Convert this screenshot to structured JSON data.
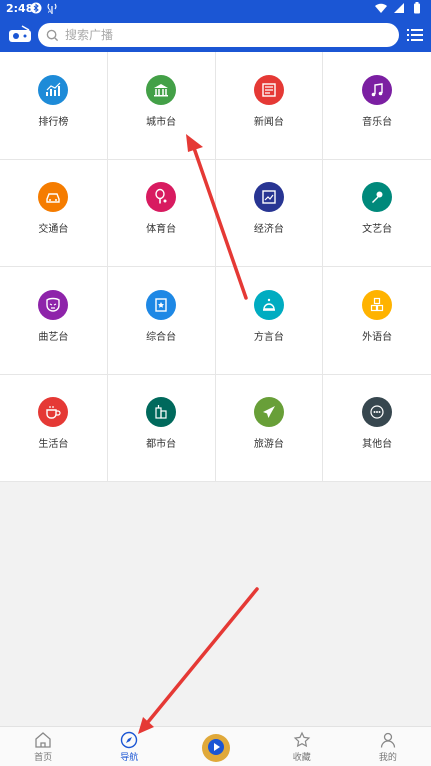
{
  "status": {
    "time": "2:48"
  },
  "search": {
    "placeholder": "搜索广播"
  },
  "categories": [
    {
      "label": "排行榜",
      "icon": "chart-growth-icon",
      "color": "#1e8bd8"
    },
    {
      "label": "城市台",
      "icon": "bank-building-icon",
      "color": "#43a047"
    },
    {
      "label": "新闻台",
      "icon": "newspaper-icon",
      "color": "#e53935"
    },
    {
      "label": "音乐台",
      "icon": "music-note-icon",
      "color": "#7b1fa2"
    },
    {
      "label": "交通台",
      "icon": "car-icon",
      "color": "#f57c00"
    },
    {
      "label": "体育台",
      "icon": "badminton-icon",
      "color": "#d81b60"
    },
    {
      "label": "经济台",
      "icon": "finance-chart-icon",
      "color": "#283593"
    },
    {
      "label": "文艺台",
      "icon": "microphone-icon",
      "color": "#00897b"
    },
    {
      "label": "曲艺台",
      "icon": "opera-mask-icon",
      "color": "#8e24aa"
    },
    {
      "label": "综合台",
      "icon": "book-star-icon",
      "color": "#1e88e5"
    },
    {
      "label": "方言台",
      "icon": "bell-icon",
      "color": "#00acc1"
    },
    {
      "label": "外语台",
      "icon": "letter-blocks-icon",
      "color": "#ffb300"
    },
    {
      "label": "生活台",
      "icon": "coffee-cup-icon",
      "color": "#e53935"
    },
    {
      "label": "都市台",
      "icon": "city-buildings-icon",
      "color": "#00695c"
    },
    {
      "label": "旅游台",
      "icon": "airplane-icon",
      "color": "#689f38"
    },
    {
      "label": "其他台",
      "icon": "more-dots-icon",
      "color": "#37474f"
    }
  ],
  "nav": {
    "home": "首页",
    "discover": "导航",
    "favorites": "收藏",
    "mine": "我的"
  },
  "colors": {
    "primary": "#1b56d4",
    "annotation": "#e53935"
  }
}
